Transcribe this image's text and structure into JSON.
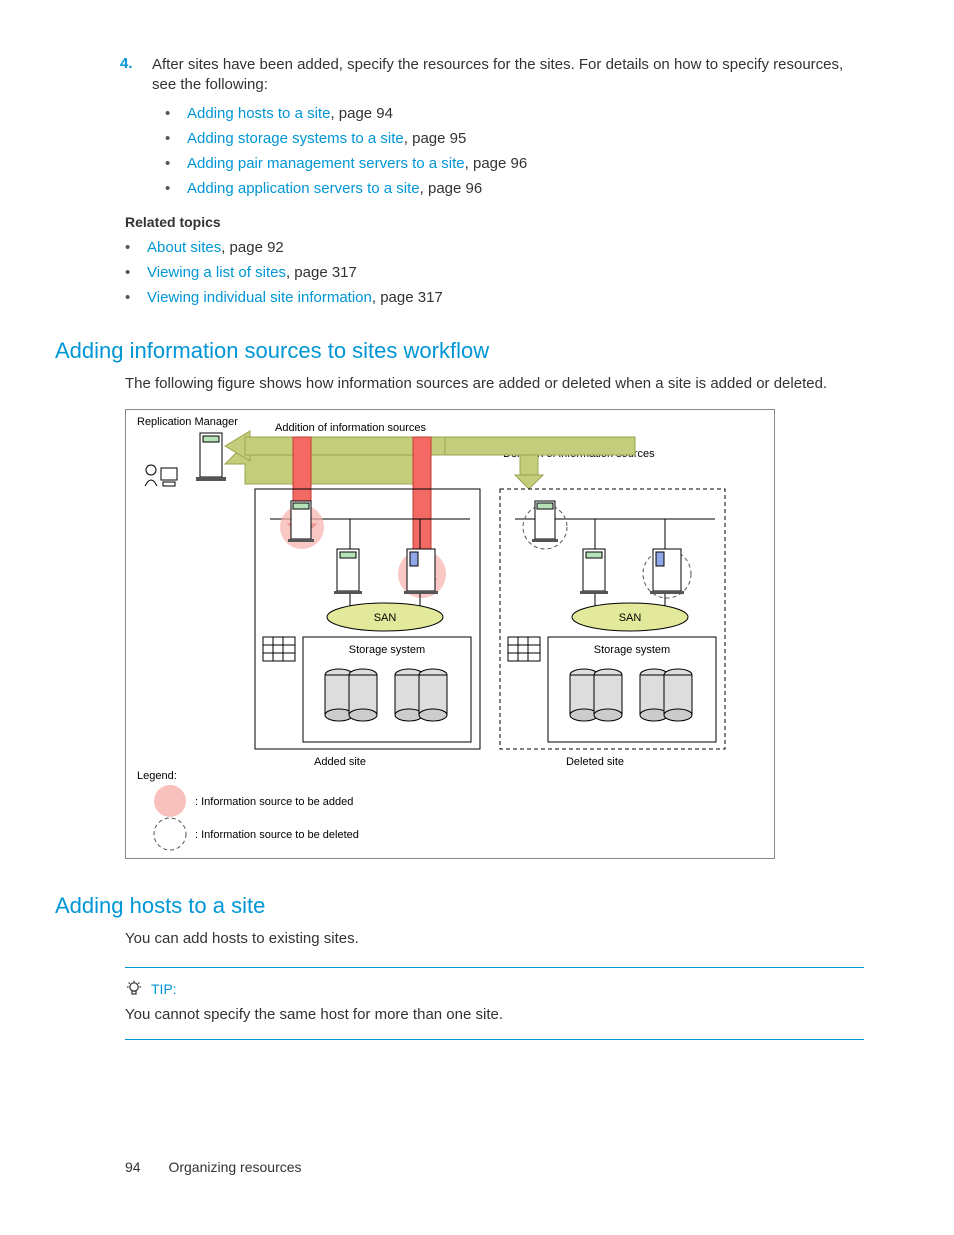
{
  "step": {
    "num": "4.",
    "text": "After sites have been added, specify the resources for the sites. For details on how to specify resources, see the following:"
  },
  "stepBullets": [
    {
      "link": "Adding hosts to a site",
      "suffix": ", page 94"
    },
    {
      "link": "Adding storage systems to a site",
      "suffix": ", page 95"
    },
    {
      "link": "Adding pair management servers to a site",
      "suffix": ", page 96"
    },
    {
      "link": "Adding application servers to a site",
      "suffix": ", page 96"
    }
  ],
  "relatedHeading": "Related topics",
  "relatedBullets": [
    {
      "link": "About sites",
      "suffix": ", page 92"
    },
    {
      "link": "Viewing a list of sites",
      "suffix": ", page 317"
    },
    {
      "link": "Viewing individual site information",
      "suffix": ", page 317"
    }
  ],
  "section1": {
    "title": "Adding information sources to sites workflow",
    "para": "The following figure shows how information sources are added or deleted when a site is added or deleted."
  },
  "diagram": {
    "repMgr": "Replication Manager",
    "addInfo": "Addition of information sources",
    "delInfo": "Deletion of information sources",
    "san": "SAN",
    "storage": "Storage system",
    "addedSite": "Added site",
    "deletedSite": "Deleted site",
    "legend": "Legend:",
    "legendAdd": ": Information source to be added",
    "legendDel": ": Information source to be deleted"
  },
  "section2": {
    "title": "Adding hosts to a site",
    "para": "You can add hosts to existing sites."
  },
  "tip": {
    "label": "TIP:",
    "text": "You cannot specify the same host for more than one site."
  },
  "footer": {
    "page": "94",
    "chapter": "Organizing resources"
  }
}
